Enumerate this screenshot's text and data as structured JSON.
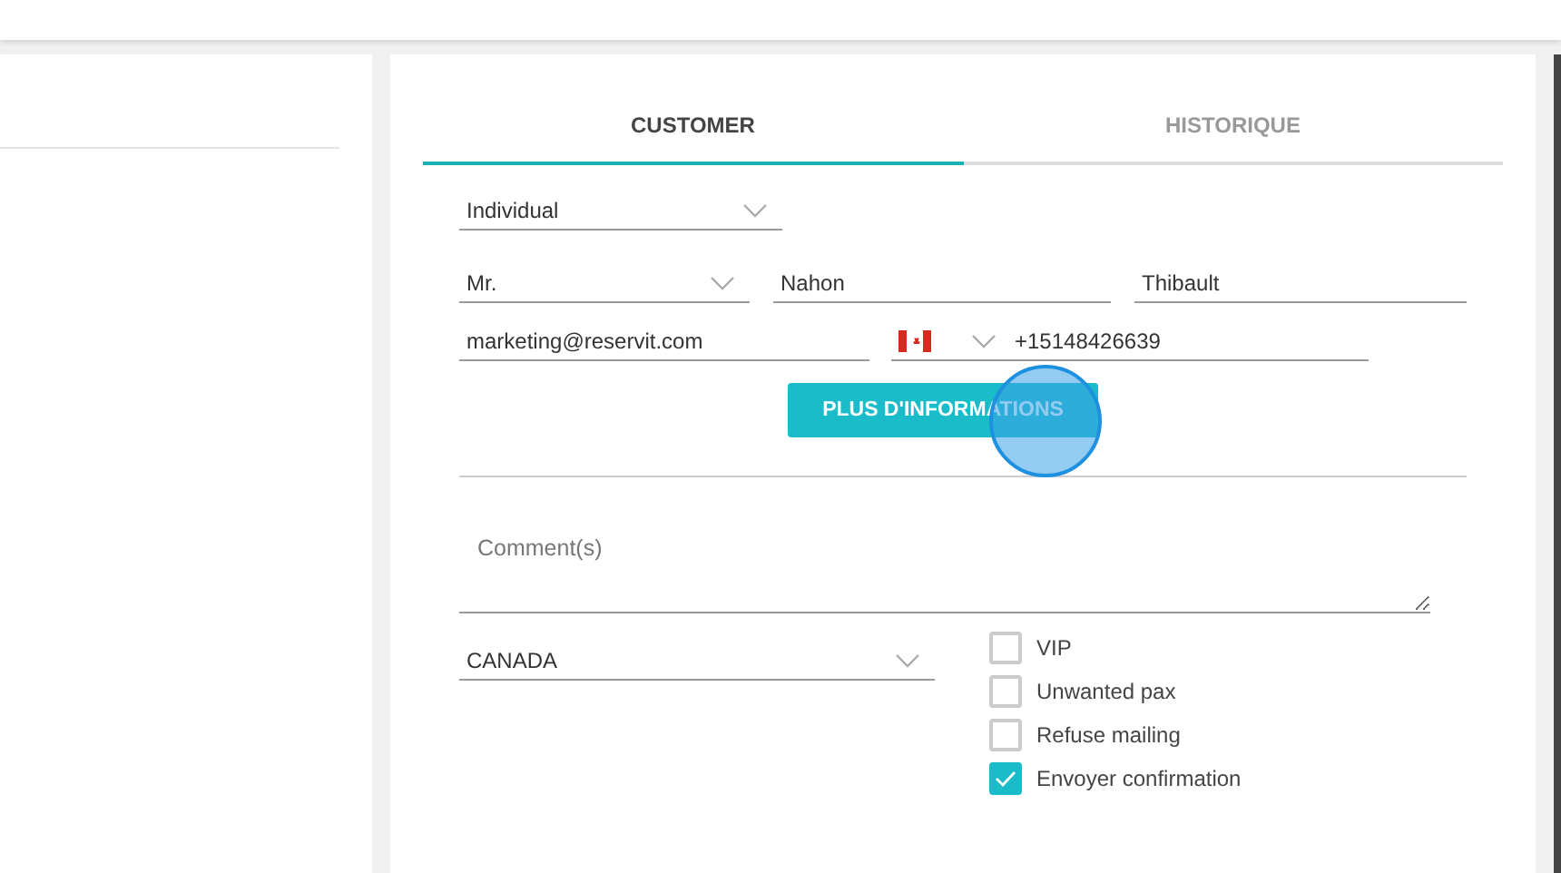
{
  "tabs": [
    {
      "label": "CUSTOMER",
      "selected": true
    },
    {
      "label": "HISTORIQUE",
      "selected": false
    }
  ],
  "customer_type": {
    "value": "Individual"
  },
  "title": {
    "value": "Mr."
  },
  "last_name": {
    "value": "Nahon"
  },
  "first_name": {
    "value": "Thibault"
  },
  "email": {
    "value": "marketing@reservit.com"
  },
  "phone": {
    "value": "+15148426639"
  },
  "more_button": {
    "label": "PLUS D'INFORMATIONS"
  },
  "comments": {
    "placeholder": "Comment(s)"
  },
  "country": {
    "value": "CANADA"
  },
  "options": [
    {
      "label": "VIP",
      "checked": false
    },
    {
      "label": "Unwanted pax",
      "checked": false
    },
    {
      "label": "Refuse mailing",
      "checked": false
    },
    {
      "label": "Envoyer confirmation",
      "checked": true
    }
  ]
}
